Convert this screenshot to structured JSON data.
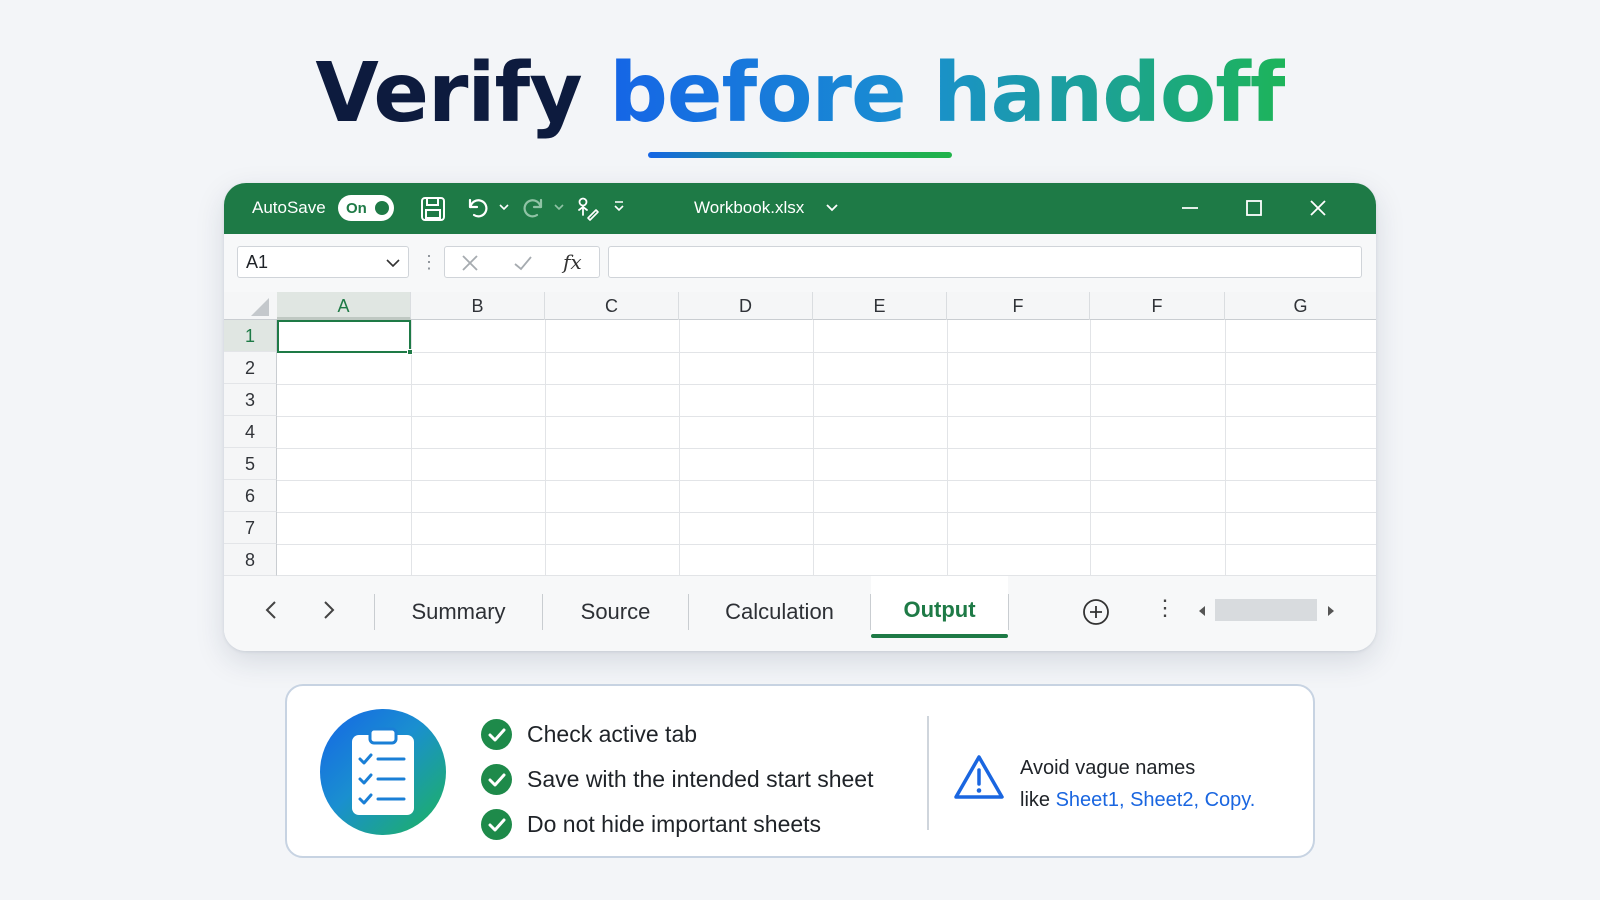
{
  "headline": {
    "part1": "Verify",
    "part2": "before handoff"
  },
  "colors": {
    "excel_green": "#1e7a46",
    "headline_dark": "#0d1b3e",
    "gradient_blue": "#1565e6",
    "gradient_green": "#1db45a",
    "link_blue": "#1a66e0"
  },
  "titlebar": {
    "autosave_label": "AutoSave",
    "autosave_state": "On",
    "file_name": "Workbook.xlsx",
    "icons": [
      "save-icon",
      "undo-icon",
      "redo-icon",
      "touch-draw-icon",
      "customize-toolbar-icon",
      "minimize-icon",
      "maximize-icon",
      "close-icon"
    ]
  },
  "formula_bar": {
    "name_box": "A1",
    "fx_label": "fx",
    "formula_value": ""
  },
  "grid": {
    "columns": [
      "A",
      "B",
      "C",
      "D",
      "E",
      "F",
      "F",
      "G"
    ],
    "rows": [
      "1",
      "2",
      "3",
      "4",
      "5",
      "6",
      "7",
      "8"
    ],
    "active_cell": "A1"
  },
  "sheet_tabs": {
    "tabs": [
      "Summary",
      "Source",
      "Calculation",
      "Output"
    ],
    "active": "Output"
  },
  "checklist": {
    "items": [
      "Check active tab",
      "Save with the intended start sheet",
      "Do not hide important sheets"
    ],
    "warning_line1": "Avoid vague names",
    "warning_prefix": "like ",
    "warning_examples": "Sheet1, Sheet2, Copy."
  }
}
